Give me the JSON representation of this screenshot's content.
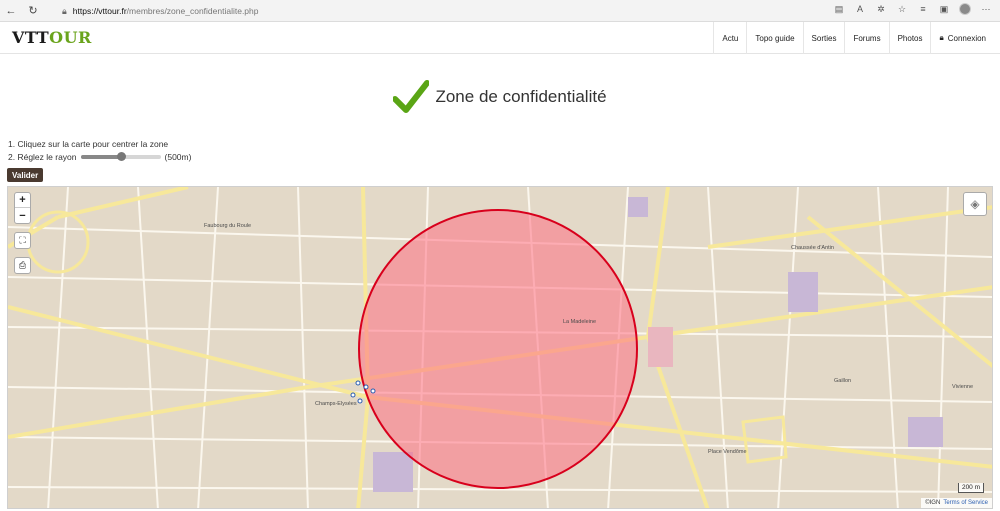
{
  "browser": {
    "url_domain": "https://vttour.fr",
    "url_path": "/membres/zone_confidentialite.php"
  },
  "site": {
    "logo_part1": "VTT",
    "logo_part2": "OUR",
    "menu": [
      "Actu",
      "Topo guide",
      "Sorties",
      "Forums",
      "Photos"
    ],
    "login_label": "Connexion"
  },
  "page": {
    "title": "Zone de confidentialité",
    "instruction_1": "1. Cliquez sur la carte pour centrer la zone",
    "instruction_2_prefix": "2. Réglez le rayon",
    "radius_label": "(500m)",
    "radius_slider_fraction": 0.5,
    "validate_label": "Valider"
  },
  "map": {
    "zoom_in": "+",
    "zoom_out": "−",
    "scale_label": "200 m",
    "attribution_ign": "©IGN",
    "attribution_tos": "Terms of Service",
    "labels": {
      "faubourg": "Faubourg du Roule",
      "chaussee": "Chaussée d'Antin",
      "madeleine": "La Madeleine",
      "champs": "Champs-Elysées",
      "gaillon": "Gaillon",
      "vivienne": "Vivienne",
      "vendome": "Place Vendôme"
    },
    "zone_fill": "#ff6f84",
    "zone_stroke": "#d8001c"
  },
  "colors": {
    "check": "#5aa515",
    "logo_accent": "#6aa41c",
    "button": "#4a3a30"
  }
}
